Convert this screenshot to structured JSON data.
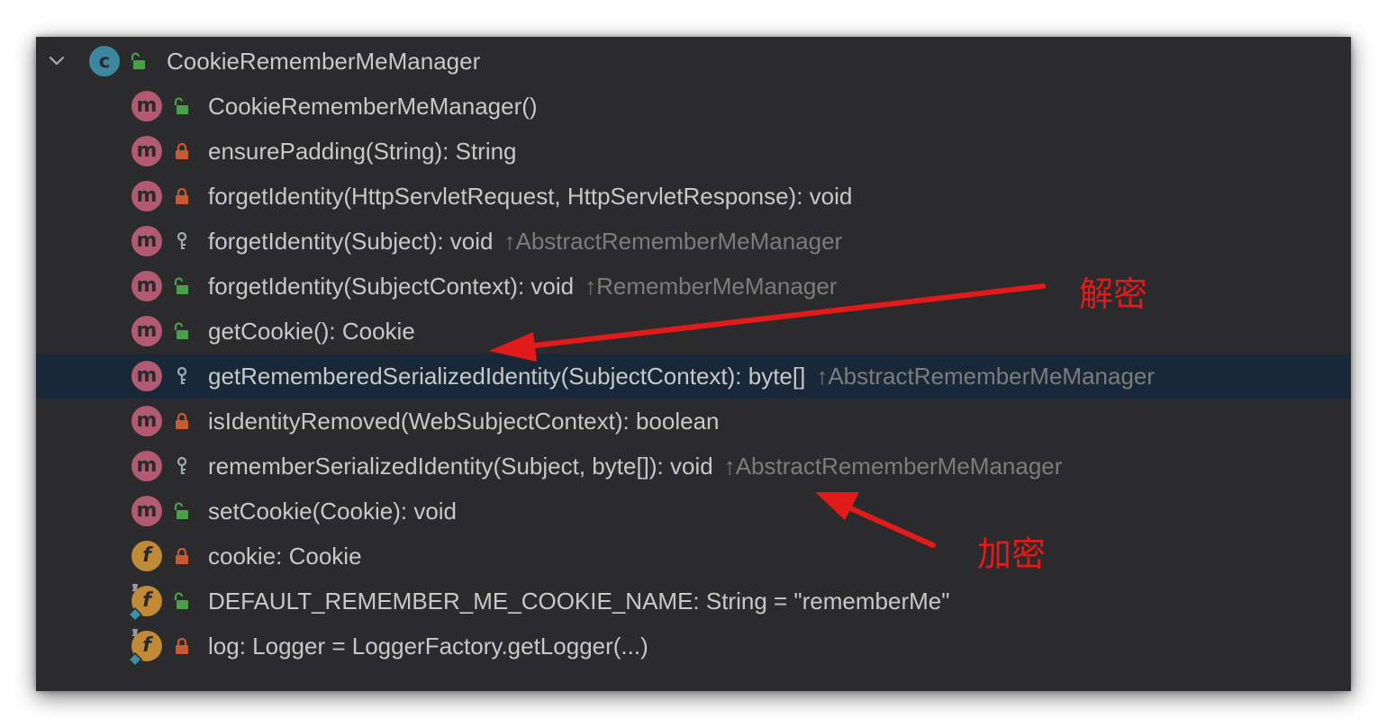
{
  "structure": {
    "class_name": "CookieRememberMeManager",
    "members": [
      {
        "kind": "method",
        "kind_letter": "m",
        "visibility": "public",
        "static": false,
        "signature": "CookieRememberMeManager()",
        "inherited_from": "",
        "selected": false
      },
      {
        "kind": "method",
        "kind_letter": "m",
        "visibility": "private",
        "static": false,
        "signature": "ensurePadding(String): String",
        "inherited_from": "",
        "selected": false
      },
      {
        "kind": "method",
        "kind_letter": "m",
        "visibility": "private",
        "static": false,
        "signature": "forgetIdentity(HttpServletRequest, HttpServletResponse): void",
        "inherited_from": "",
        "selected": false
      },
      {
        "kind": "method",
        "kind_letter": "m",
        "visibility": "protected",
        "static": false,
        "signature": "forgetIdentity(Subject): void",
        "inherited_from": "↑AbstractRememberMeManager",
        "selected": false
      },
      {
        "kind": "method",
        "kind_letter": "m",
        "visibility": "public",
        "static": false,
        "signature": "forgetIdentity(SubjectContext): void",
        "inherited_from": "↑RememberMeManager",
        "selected": false
      },
      {
        "kind": "method",
        "kind_letter": "m",
        "visibility": "public",
        "static": false,
        "signature": "getCookie(): Cookie",
        "inherited_from": "",
        "selected": false
      },
      {
        "kind": "method",
        "kind_letter": "m",
        "visibility": "protected",
        "static": false,
        "signature": "getRememberedSerializedIdentity(SubjectContext): byte[]",
        "inherited_from": "↑AbstractRememberMeManager",
        "selected": true
      },
      {
        "kind": "method",
        "kind_letter": "m",
        "visibility": "private",
        "static": false,
        "signature": "isIdentityRemoved(WebSubjectContext): boolean",
        "inherited_from": "",
        "selected": false
      },
      {
        "kind": "method",
        "kind_letter": "m",
        "visibility": "protected",
        "static": false,
        "signature": "rememberSerializedIdentity(Subject, byte[]): void",
        "inherited_from": "↑AbstractRememberMeManager",
        "selected": false
      },
      {
        "kind": "method",
        "kind_letter": "m",
        "visibility": "public",
        "static": false,
        "signature": "setCookie(Cookie): void",
        "inherited_from": "",
        "selected": false
      },
      {
        "kind": "field",
        "kind_letter": "f",
        "visibility": "private",
        "static": false,
        "signature": "cookie: Cookie",
        "inherited_from": "",
        "selected": false
      },
      {
        "kind": "field",
        "kind_letter": "f",
        "visibility": "public",
        "static": true,
        "signature": "DEFAULT_REMEMBER_ME_COOKIE_NAME: String = \"rememberMe\"",
        "inherited_from": "",
        "selected": false
      },
      {
        "kind": "field",
        "kind_letter": "f",
        "visibility": "private",
        "static": true,
        "signature": "log: Logger = LoggerFactory.getLogger(...)",
        "inherited_from": "",
        "selected": false
      }
    ]
  },
  "annotations": {
    "decrypt_label": "解密",
    "encrypt_label": "加密"
  },
  "colors": {
    "panel_bg": "#2b2b2d",
    "selected_row": "#182838",
    "text": "#c8c8c8",
    "inherited_text": "#7c7c7c",
    "class_badge": "#3e86a0",
    "method_badge": "#b25a72",
    "field_badge": "#c08a36",
    "public_icon": "#4aa04a",
    "private_icon": "#c85a32",
    "protected_icon": "#a0a8b0",
    "annotation_red": "#e11a1a"
  },
  "icons": {
    "expand": "chevron-down-icon",
    "public": "unlocked-padlock-icon",
    "private": "locked-padlock-icon",
    "protected": "key-icon",
    "static": "pin-icon"
  }
}
